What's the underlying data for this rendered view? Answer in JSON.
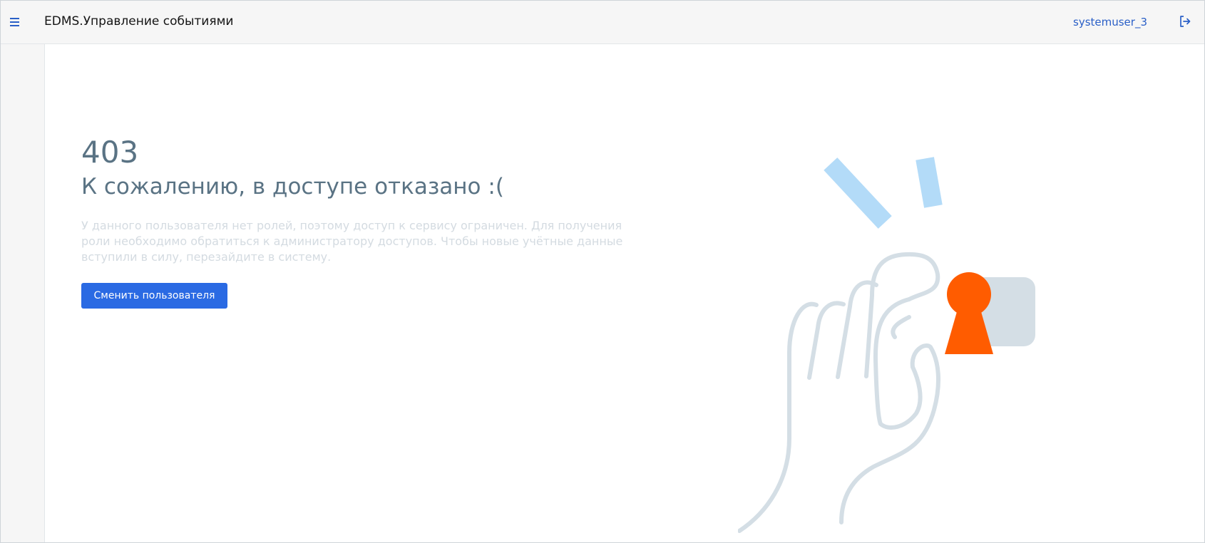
{
  "header": {
    "menu_icon": "hamburger-menu-icon",
    "app_title": "EDMS.Управление событиями",
    "username": "systemuser_3",
    "logout_icon": "logout-icon",
    "accent_color": "#2a5fc7"
  },
  "error": {
    "code": "403",
    "title": "К сожалению, в доступе отказано :(",
    "description": "У данного пользователя нет ролей, поэтому доступ к сервису ограничен. Для получения роли необходимо обратиться к администратору доступов. Чтобы новые учётные данные вступили в силу, перезайдите в систему.",
    "switch_user_label": "Сменить пользователя",
    "title_color": "#5a7384",
    "description_color": "#d4dbe1",
    "button_color": "#2a6ae3"
  },
  "illustration": {
    "icon": "hand-keyhole-illustration",
    "line_color": "#d4dee5",
    "keyhole_color": "#ff5c00",
    "accent_light_blue": "#b3dbf8",
    "block_color": "#d4dee5"
  }
}
